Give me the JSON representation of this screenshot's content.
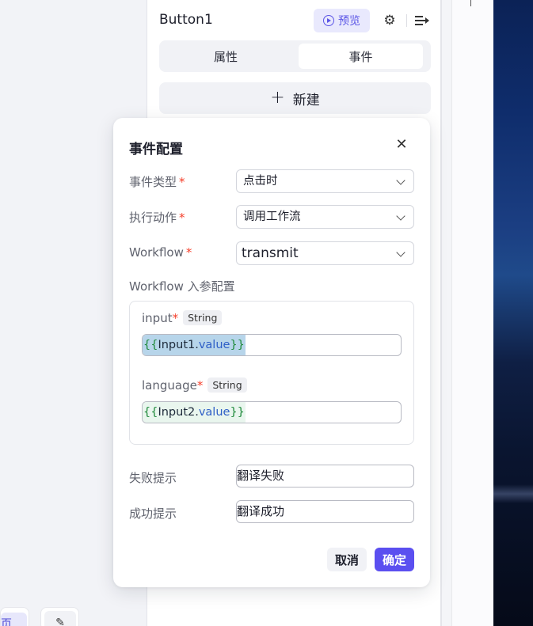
{
  "panel": {
    "title": "Button1",
    "preview_label": "预览",
    "tabs": [
      {
        "label": "属性",
        "active": false
      },
      {
        "label": "事件",
        "active": true
      }
    ],
    "new_button_label": "新建",
    "new_button_icon": "plus-icon"
  },
  "bottom_fragments": {
    "left_text": "页",
    "right_icon": "wrench-icon"
  },
  "modal": {
    "title": "事件配置",
    "fields": {
      "event_type": {
        "label": "事件类型",
        "required": "*",
        "value": "点击时"
      },
      "action": {
        "label": "执行动作",
        "required": "*",
        "value": "调用工作流"
      },
      "workflow": {
        "label": "Workflow",
        "required": "*",
        "value": "transmit"
      }
    },
    "params": {
      "label": "Workflow 入参配置",
      "items": [
        {
          "name": "input",
          "required": "*",
          "type": "String",
          "open": "{{",
          "object": "Input1.",
          "property": "value",
          "close": "}}"
        },
        {
          "name": "language",
          "required": "*",
          "type": "String",
          "open": "{{",
          "object": "Input2.",
          "property": "value",
          "close": "}}"
        }
      ]
    },
    "fail_tip": {
      "label": "失败提示",
      "value": "翻译失败"
    },
    "success_tip": {
      "label": "成功提示",
      "value": "翻译成功"
    },
    "cancel_label": "取消",
    "confirm_label": "确定"
  },
  "colors": {
    "accent": "#5b4ff0",
    "required": "#f5402c",
    "preview_bg": "#e9e9fd",
    "expression_bracket": "#1f8a3b",
    "expression_property": "#2e5fc7"
  }
}
